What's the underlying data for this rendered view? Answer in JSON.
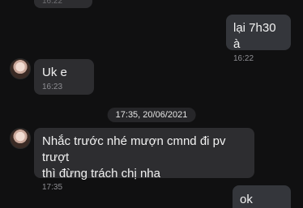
{
  "messages": {
    "top_partial": {
      "time": "16:22"
    },
    "out1": {
      "text": "lại 7h30 à",
      "time": "16:22"
    },
    "in1": {
      "text": "Uk e",
      "time": "16:23"
    },
    "in2": {
      "text": "Nhắc trước nhé mượn cmnd đi pv trượt\nthì đừng trách chị nha",
      "time": "17:35"
    },
    "out2": {
      "text": "ok"
    }
  },
  "date_divider": "17:35, 20/06/2021",
  "colors": {
    "background": "#101011",
    "incoming_bubble": "#2d2d30",
    "outgoing_bubble": "#34363b",
    "timestamp": "#8e8e93"
  }
}
